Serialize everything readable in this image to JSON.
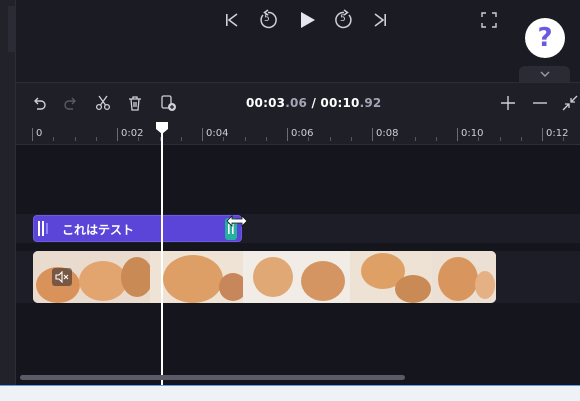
{
  "player": {
    "icons": [
      "skip-back-icon",
      "rewind-5-icon",
      "play-icon",
      "forward-5-icon",
      "skip-forward-icon",
      "fullscreen-icon"
    ],
    "rewind_seconds": "5",
    "forward_seconds": "5"
  },
  "help": {
    "label": "?"
  },
  "toolbar": {
    "icons": [
      "undo-icon",
      "redo-icon",
      "cut-icon",
      "delete-icon",
      "duplicate-icon",
      "zoom-in-icon",
      "zoom-out-icon",
      "collapse-icon"
    ],
    "timecode": {
      "current_main": "00:03",
      "current_frac": ".06",
      "separator": " / ",
      "total_main": "00:10",
      "total_frac": ".92"
    }
  },
  "ruler": {
    "labels": [
      "0",
      "0:02",
      "0:04",
      "0:06",
      "0:08",
      "0:10",
      "0:12"
    ]
  },
  "tracks": {
    "text_clip": {
      "label": "これはテスト",
      "color": "#5b45d8",
      "handle_color": "#25b0a0"
    },
    "video_clip": {
      "muted": true
    }
  },
  "playhead": {
    "time_seconds": 3.06
  },
  "colors": {
    "accent": "#6a5ae0",
    "background": "#1b1b24"
  }
}
